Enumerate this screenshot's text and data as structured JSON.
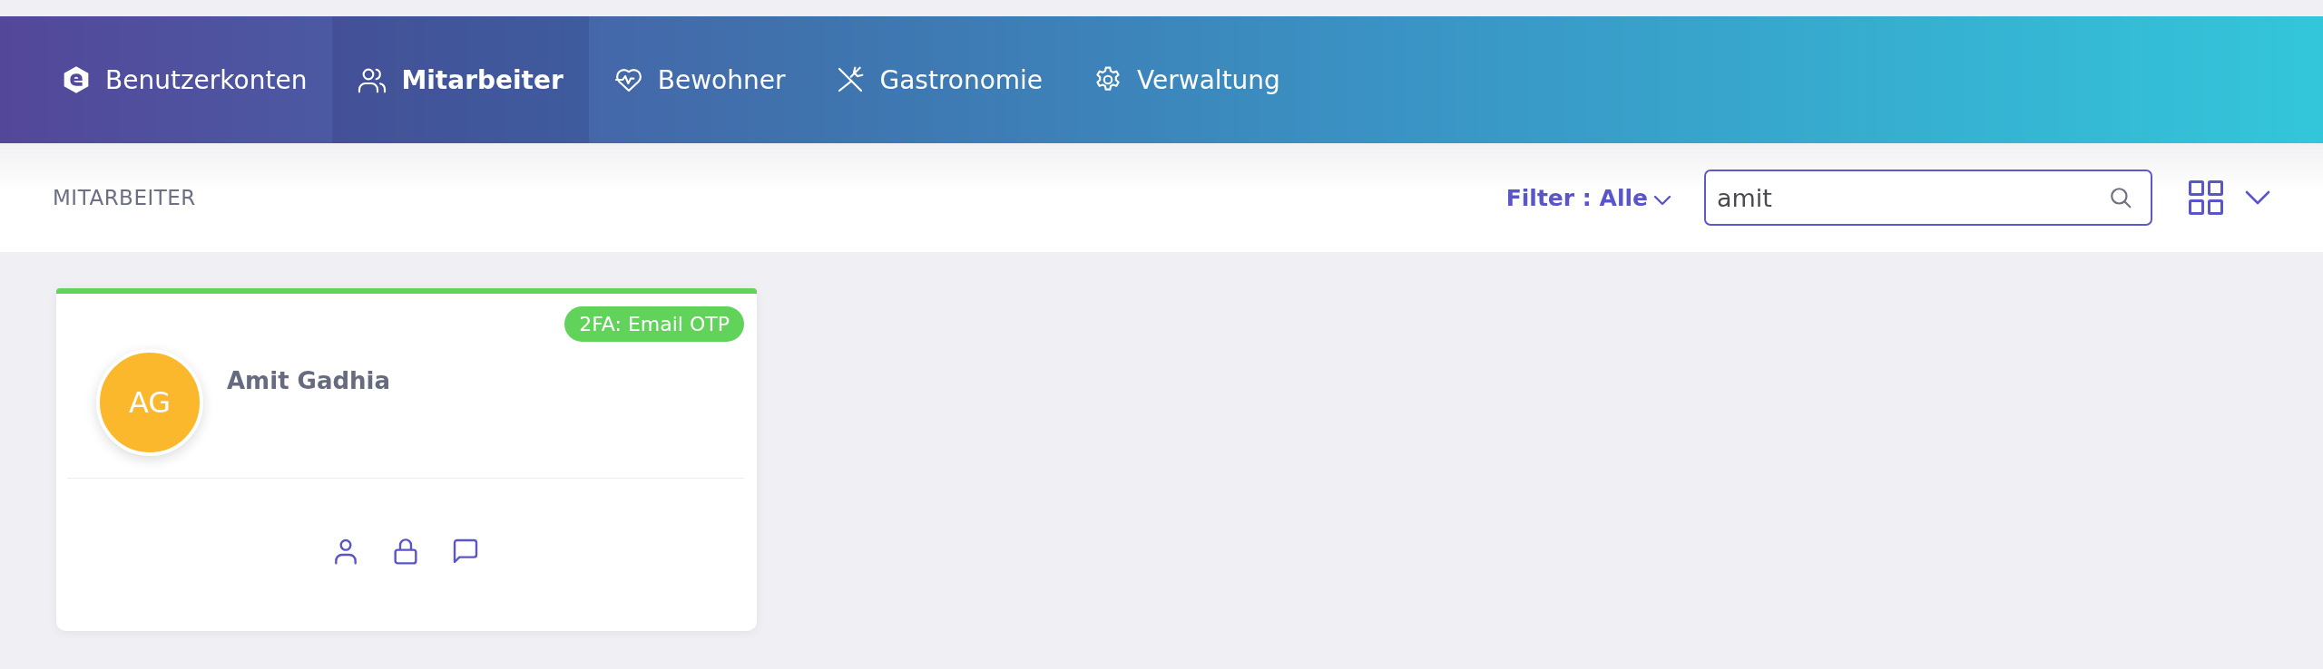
{
  "nav": {
    "items": [
      {
        "label": "Benutzerkonten",
        "selected": false
      },
      {
        "label": "Mitarbeiter",
        "selected": true
      },
      {
        "label": "Bewohner",
        "selected": false
      },
      {
        "label": "Gastronomie",
        "selected": false
      },
      {
        "label": "Verwaltung",
        "selected": false
      }
    ]
  },
  "toolbar": {
    "title": "MITARBEITER",
    "filter": {
      "label": "Filter : Alle"
    },
    "search": {
      "value": "amit"
    }
  },
  "cards": [
    {
      "initials": "AG",
      "name": "Amit Gadhia",
      "badge": "2FA: Email OTP"
    }
  ]
}
